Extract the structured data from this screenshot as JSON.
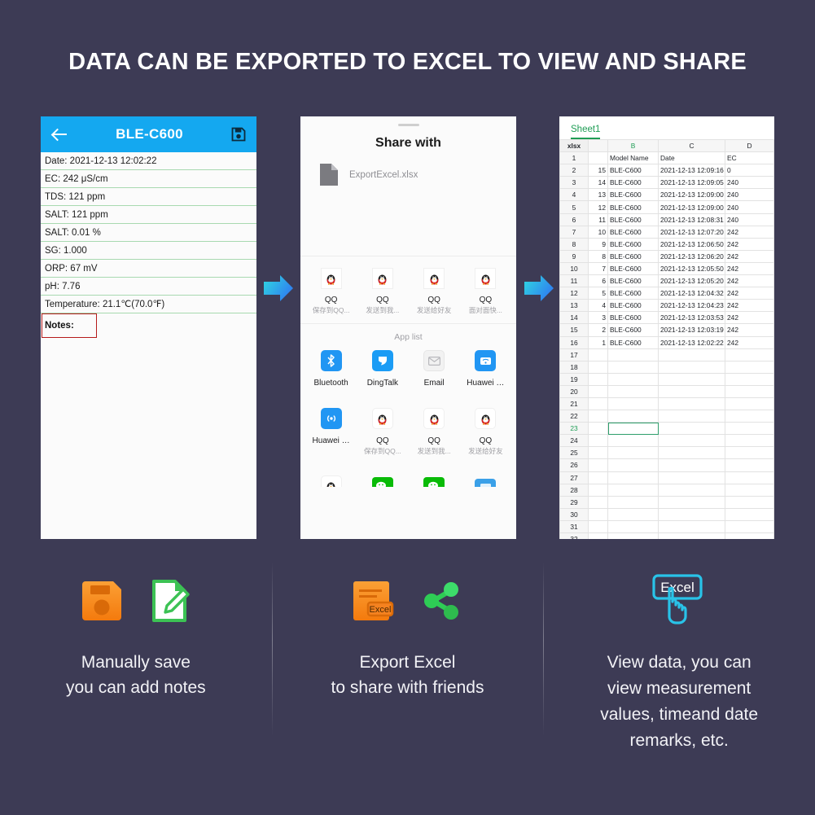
{
  "headline": "DATA CAN BE EXPORTED TO EXCEL TO VIEW AND SHARE",
  "colors": {
    "background": "#3d3b55",
    "app_header": "#14a8f0",
    "row_divider": "#a8d9b0",
    "notes_highlight": "#b51b1b",
    "arrow_start": "#2fd9e0",
    "arrow_end": "#2f7ef0",
    "excel_green": "#1f9d55",
    "save_orange": "#f58220",
    "note_green": "#3cc254",
    "share_green": "#2ecc55",
    "cursor_cyan": "#29c3e8"
  },
  "phone_app": {
    "back_icon": "back-arrow-icon",
    "title": "BLE-C600",
    "save_icon": "save-disk-icon",
    "rows": [
      "Date: 2021-12-13 12:02:22",
      "EC: 242 μS/cm",
      "TDS: 121 ppm",
      "SALT: 121 ppm",
      "SALT: 0.01 %",
      "SG: 1.000",
      "ORP: 67 mV",
      "pH: 7.76",
      "Temperature: 21.1℃(70.0℉)"
    ],
    "notes_label": "Notes:"
  },
  "share_sheet": {
    "title": "Share with",
    "file_icon": "document-file-icon",
    "file_name": "ExportExcel.xlsx",
    "targets": [
      {
        "icon": "qq-penguin-icon",
        "name": "QQ",
        "sub": "保存到QQ..."
      },
      {
        "icon": "qq-penguin-icon",
        "name": "QQ",
        "sub": "发送到我..."
      },
      {
        "icon": "qq-penguin-icon",
        "name": "QQ",
        "sub": "发送给好友"
      },
      {
        "icon": "qq-penguin-icon",
        "name": "QQ",
        "sub": "面对面快..."
      }
    ],
    "app_list_label": "App list",
    "apps_row1": [
      {
        "icon": "bluetooth-icon",
        "name": "Bluetooth",
        "sub": ""
      },
      {
        "icon": "dingtalk-icon",
        "name": "DingTalk",
        "sub": ""
      },
      {
        "icon": "email-icon",
        "name": "Email",
        "sub": ""
      },
      {
        "icon": "huawei-share-icon",
        "name": "Huawei …",
        "sub": ""
      }
    ],
    "apps_row2": [
      {
        "icon": "huawei-nfc-icon",
        "name": "Huawei …",
        "sub": ""
      },
      {
        "icon": "qq-penguin-icon",
        "name": "QQ",
        "sub": "保存到QQ..."
      },
      {
        "icon": "qq-penguin-icon",
        "name": "QQ",
        "sub": "发送到我..."
      },
      {
        "icon": "qq-penguin-icon",
        "name": "QQ",
        "sub": "发送给好友"
      }
    ],
    "apps_row3_clipped": [
      {
        "icon": "qq-penguin-icon",
        "name": "",
        "sub": ""
      },
      {
        "icon": "wechat-icon",
        "name": "",
        "sub": ""
      },
      {
        "icon": "wechat-icon",
        "name": "",
        "sub": ""
      },
      {
        "icon": "app-icon",
        "name": "",
        "sub": ""
      }
    ]
  },
  "excel": {
    "sheet_tab": "Sheet1",
    "corner_label": "xlsx",
    "column_headers": [
      "",
      "B",
      "C",
      "D"
    ],
    "highlighted_column": "B",
    "selected_cell": {
      "row": 23,
      "column": "B"
    },
    "total_visible_rows": 34,
    "chart_data": {
      "type": "table",
      "title": "Sheet1",
      "columns": [
        "",
        "Model Name",
        "Date",
        "EC"
      ],
      "rows": [
        [
          "",
          "Model Name",
          "Date",
          "EC"
        ],
        [
          "15",
          "BLE-C600",
          "2021-12-13 12:09:16",
          "0"
        ],
        [
          "14",
          "BLE-C600",
          "2021-12-13 12:09:05",
          "240"
        ],
        [
          "13",
          "BLE-C600",
          "2021-12-13 12:09:00",
          "240"
        ],
        [
          "12",
          "BLE-C600",
          "2021-12-13 12:09:00",
          "240"
        ],
        [
          "11",
          "BLE-C600",
          "2021-12-13 12:08:31",
          "240"
        ],
        [
          "10",
          "BLE-C600",
          "2021-12-13 12:07:20",
          "242"
        ],
        [
          "9",
          "BLE-C600",
          "2021-12-13 12:06:50",
          "242"
        ],
        [
          "8",
          "BLE-C600",
          "2021-12-13 12:06:20",
          "242"
        ],
        [
          "7",
          "BLE-C600",
          "2021-12-13 12:05:50",
          "242"
        ],
        [
          "6",
          "BLE-C600",
          "2021-12-13 12:05:20",
          "242"
        ],
        [
          "5",
          "BLE-C600",
          "2021-12-13 12:04:32",
          "242"
        ],
        [
          "4",
          "BLE-C600",
          "2021-12-13 12:04:23",
          "242"
        ],
        [
          "3",
          "BLE-C600",
          "2021-12-13 12:03:53",
          "242"
        ],
        [
          "2",
          "BLE-C600",
          "2021-12-13 12:03:19",
          "242"
        ],
        [
          "1",
          "BLE-C600",
          "2021-12-13 12:02:22",
          "242"
        ]
      ]
    }
  },
  "features": [
    {
      "icons": [
        "save-disk-orange-icon",
        "note-edit-green-icon"
      ],
      "caption_line1": "Manually save",
      "caption_line2": "you can add notes"
    },
    {
      "icons": [
        "excel-export-orange-icon",
        "share-nodes-green-icon"
      ],
      "caption_line1": "Export Excel",
      "caption_line2": "to share with friends"
    },
    {
      "icons": [
        "excel-click-cursor-icon"
      ],
      "caption_line1": "View data, you can",
      "caption_line2": "view measurement",
      "caption_line3": "values, timeand date",
      "caption_line4": "remarks, etc."
    }
  ]
}
